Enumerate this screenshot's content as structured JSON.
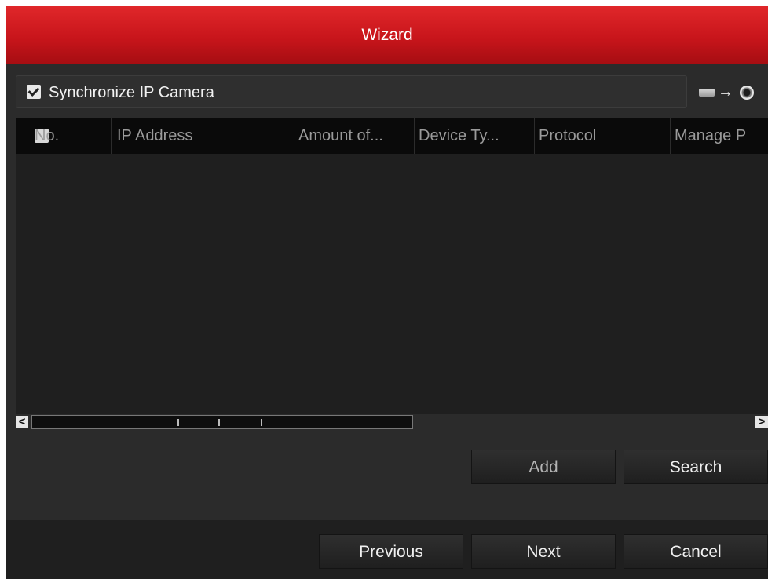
{
  "window": {
    "title": "Wizard"
  },
  "sync": {
    "checked": true,
    "label": "Synchronize IP Camera"
  },
  "sync_icons": [
    "hdd-icon",
    "arrow-right-icon",
    "ip-camera-icon"
  ],
  "table": {
    "select_all_checked": false,
    "columns": [
      "No.",
      "IP Address",
      "Amount of...",
      "Device Ty...",
      "Protocol",
      "Manage P"
    ],
    "rows": []
  },
  "scrollbar": {
    "left_arrow": "<",
    "right_arrow": ">"
  },
  "actions": {
    "add_label": "Add",
    "search_label": "Search"
  },
  "footer": {
    "previous_label": "Previous",
    "next_label": "Next",
    "cancel_label": "Cancel"
  },
  "colors": {
    "title_bar": "#d01c22",
    "background": "#2b2b2b",
    "header": "#0a0a0a"
  }
}
